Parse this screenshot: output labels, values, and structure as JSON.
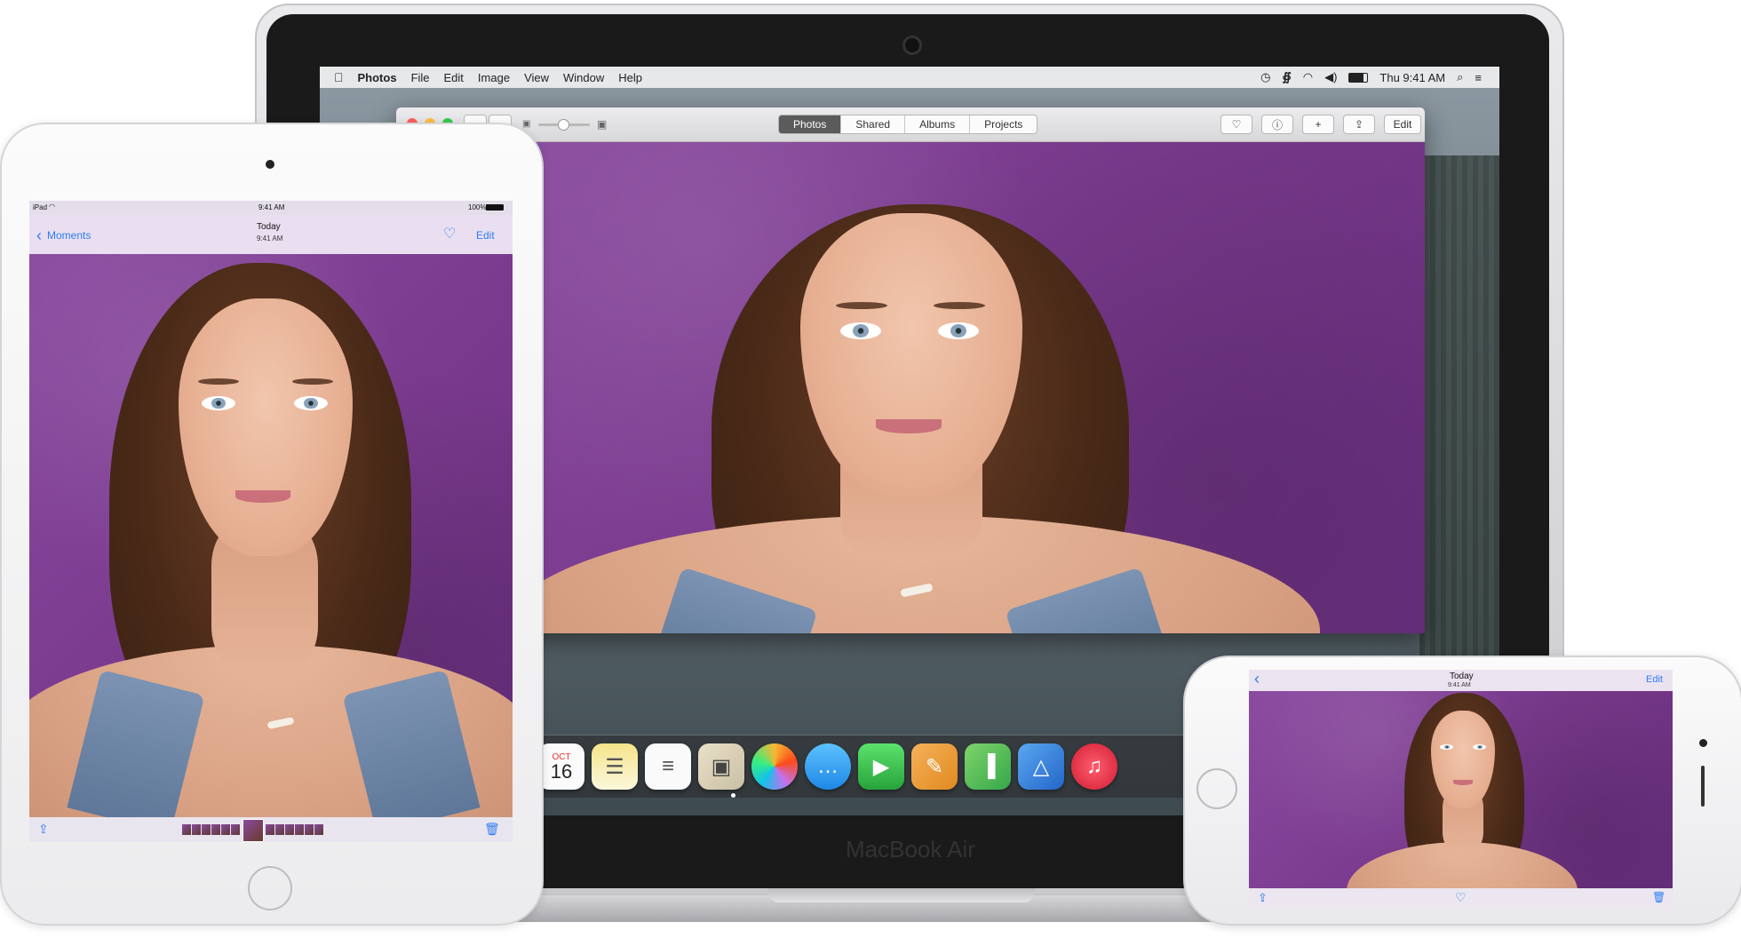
{
  "macbook": {
    "model_label": "MacBook Air",
    "menubar": {
      "app_name": "Photos",
      "menus": [
        "File",
        "Edit",
        "Image",
        "View",
        "Window",
        "Help"
      ],
      "clock": "Thu 9:41 AM"
    },
    "photos_window": {
      "tabs": [
        {
          "label": "Photos",
          "active": true
        },
        {
          "label": "Shared",
          "active": false
        },
        {
          "label": "Albums",
          "active": false
        },
        {
          "label": "Projects",
          "active": false
        }
      ],
      "edit_label": "Edit",
      "toolbar_icons": [
        "heart-icon",
        "info-icon",
        "plus-icon",
        "share-icon"
      ]
    },
    "dock": {
      "calendar_month": "OCT",
      "calendar_day": "16",
      "items": [
        "mail-icon",
        "contacts-icon",
        "calendar-icon",
        "notes-icon",
        "reminders-icon",
        "preview-icon",
        "photos-icon",
        "messages-icon",
        "facetime-icon",
        "pages-icon",
        "numbers-icon",
        "keynote-icon",
        "itunes-icon"
      ]
    }
  },
  "ipad": {
    "status": {
      "carrier": "iPad",
      "time": "9:41 AM",
      "battery": "100%"
    },
    "nav": {
      "back_label": "Moments",
      "title": "Today",
      "subtitle": "9:41 AM",
      "edit_label": "Edit"
    }
  },
  "iphone": {
    "nav": {
      "title": "Today",
      "subtitle": "9:41 AM",
      "edit_label": "Edit"
    }
  },
  "colors": {
    "accent": "#2f7cf6",
    "wall": "#7d3f8f"
  }
}
